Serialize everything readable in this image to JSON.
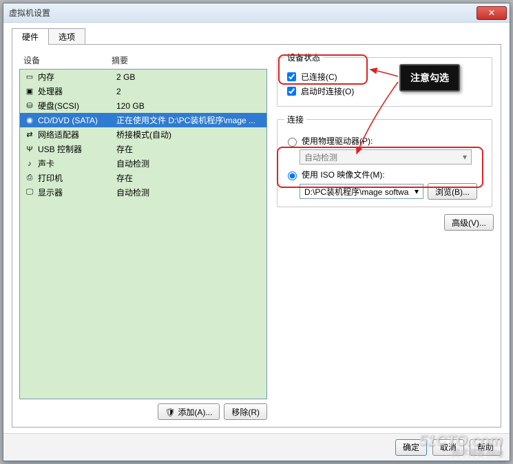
{
  "window": {
    "title": "虚拟机设置"
  },
  "tabs": {
    "hardware": "硬件",
    "options": "选项"
  },
  "columns": {
    "device": "设备",
    "summary": "摘要"
  },
  "rows": [
    {
      "icon": "memory-icon",
      "name": "内存",
      "summary": "2 GB"
    },
    {
      "icon": "cpu-icon",
      "name": "处理器",
      "summary": "2"
    },
    {
      "icon": "disk-icon",
      "name": "硬盘(SCSI)",
      "summary": "120 GB"
    },
    {
      "icon": "cd-icon",
      "name": "CD/DVD (SATA)",
      "summary": "正在使用文件 D:\\PC装机程序\\mage ...",
      "selected": true
    },
    {
      "icon": "nic-icon",
      "name": "网络适配器",
      "summary": "桥接模式(自动)"
    },
    {
      "icon": "usb-icon",
      "name": "USB 控制器",
      "summary": "存在"
    },
    {
      "icon": "sound-icon",
      "name": "声卡",
      "summary": "自动检测"
    },
    {
      "icon": "printer-icon",
      "name": "打印机",
      "summary": "存在"
    },
    {
      "icon": "display-icon",
      "name": "显示器",
      "summary": "自动检测"
    }
  ],
  "leftButtons": {
    "add": "添加(A)...",
    "remove": "移除(R)"
  },
  "status": {
    "legend": "设备状态",
    "connected": {
      "label": "已连接(C)",
      "checked": true
    },
    "connectAtPowerOn": {
      "label": "启动时连接(O)",
      "checked": true
    }
  },
  "connection": {
    "legend": "连接",
    "physical": {
      "label": "使用物理驱动器(P):",
      "selected": false,
      "dropdown": "自动检测"
    },
    "iso": {
      "label": "使用 ISO 映像文件(M):",
      "selected": true,
      "path": "D:\\PC装机程序\\mage softwa",
      "browse": "浏览(B)..."
    }
  },
  "advanced": "高级(V)...",
  "bottom": {
    "ok": "确定",
    "cancel": "取消",
    "help": "帮助"
  },
  "annotation": "注意勾选",
  "watermark": {
    "main": "51CTO.com",
    "sub": "技术博客 Blog"
  },
  "icons": {
    "memory-icon": "▭",
    "cpu-icon": "▣",
    "disk-icon": "⛁",
    "cd-icon": "◉",
    "nic-icon": "⇄",
    "usb-icon": "Ψ",
    "sound-icon": "♪",
    "printer-icon": "⎙",
    "display-icon": "🖵",
    "shield-icon": "🛡",
    "chevron-down-icon": "▾"
  }
}
